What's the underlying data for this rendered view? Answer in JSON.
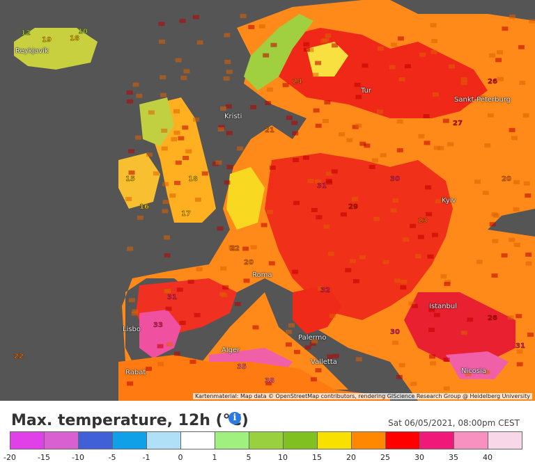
{
  "map": {
    "attribution": "Kartenmaterial: Map data © OpenStreetMap contributors, rendering GIScience Research Group @ Heidelberg University",
    "cities": [
      {
        "name": "Reykjavík"
      },
      {
        "name": "Kristi"
      },
      {
        "name": "Tur"
      },
      {
        "name": "Sankt-Peterburg"
      },
      {
        "name": "Kyiv"
      },
      {
        "name": "Istanbul"
      },
      {
        "name": "Roma"
      },
      {
        "name": "Alger"
      },
      {
        "name": "Rabat"
      },
      {
        "name": "Lisbo"
      },
      {
        "name": "Valletta"
      },
      {
        "name": "Palermo"
      },
      {
        "name": "Nicosia"
      }
    ],
    "sample_values": [
      {
        "name": "iceland-12",
        "v": 12
      },
      {
        "name": "iceland-19",
        "v": 19
      },
      {
        "name": "iceland-18",
        "v": 18
      },
      {
        "name": "iceland-10",
        "v": 10
      },
      {
        "name": "ireland-15",
        "v": 15
      },
      {
        "name": "ireland-16",
        "v": 16
      },
      {
        "name": "uk-18",
        "v": 18
      },
      {
        "name": "uk-17",
        "v": 17
      },
      {
        "name": "france-20",
        "v": 20
      },
      {
        "name": "france-22",
        "v": 22
      },
      {
        "name": "germany-31",
        "v": 31
      },
      {
        "name": "germany-29",
        "v": 29
      },
      {
        "name": "poland-30",
        "v": 30
      },
      {
        "name": "spain-33",
        "v": 33
      },
      {
        "name": "spain-31",
        "v": 31
      },
      {
        "name": "italy-32",
        "v": 32
      },
      {
        "name": "greece-30",
        "v": 30
      },
      {
        "name": "russia-27",
        "v": 27
      },
      {
        "name": "russia-26",
        "v": 26
      },
      {
        "name": "turkey-26",
        "v": 26
      },
      {
        "name": "scand-24",
        "v": 24
      },
      {
        "name": "scand-21",
        "v": 21
      },
      {
        "name": "north-africa-35",
        "v": 35
      },
      {
        "name": "north-africa-38",
        "v": 38
      },
      {
        "name": "ukraine-23",
        "v": 23
      },
      {
        "name": "russia-east-20",
        "v": 20
      },
      {
        "name": "caspian-31",
        "v": 31
      },
      {
        "name": "atlantic-22",
        "v": 22
      }
    ]
  },
  "legend": {
    "title": "Max. temperature, 12h (°C)",
    "datetime": "Sat 06/05/2021, 08:00pm CEST",
    "colors": [
      "#e040e8",
      "#d860d0",
      "#4060d8",
      "#10a0e8",
      "#b0e0f8",
      "#ffffff",
      "#a0f080",
      "#98d040",
      "#80c020",
      "#f8e000",
      "#ff8800",
      "#ff0000",
      "#f01878",
      "#f890c0",
      "#f8d8e8"
    ],
    "ticks": [
      "-20",
      "-15",
      "-10",
      "-5",
      "-1",
      "0",
      "1",
      "5",
      "10",
      "15",
      "20",
      "25",
      "30",
      "35",
      "40"
    ]
  }
}
